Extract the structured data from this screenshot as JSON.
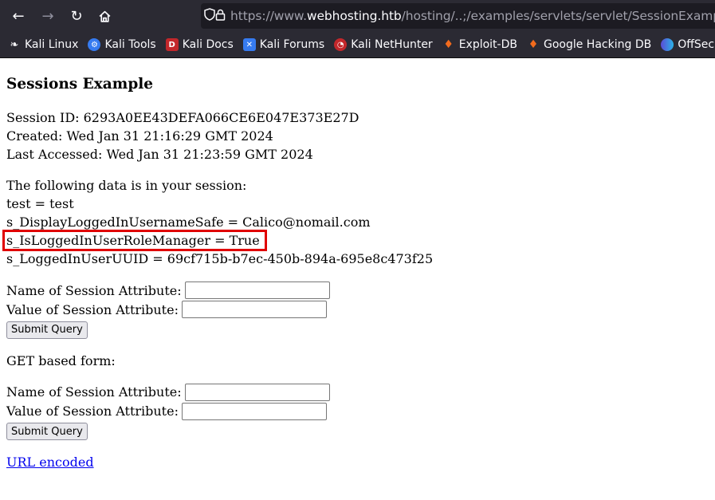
{
  "browser": {
    "url": {
      "scheme": "https://www.",
      "host": "webhosting.htb",
      "path": "/hosting/..;/examples/servlets/servlet/SessionExample"
    },
    "bookmarks": [
      {
        "label": "Kali Linux",
        "icon": "kali-dragon-icon"
      },
      {
        "label": "Kali Tools",
        "icon": "kali-tools-icon"
      },
      {
        "label": "Kali Docs",
        "icon": "kali-docs-icon"
      },
      {
        "label": "Kali Forums",
        "icon": "kali-forums-icon"
      },
      {
        "label": "Kali NetHunter",
        "icon": "kali-nethunter-icon"
      },
      {
        "label": "Exploit-DB",
        "icon": "exploit-db-icon"
      },
      {
        "label": "Google Hacking DB",
        "icon": "ghdb-icon"
      },
      {
        "label": "OffSec",
        "icon": "offsec-icon"
      }
    ]
  },
  "page": {
    "title": "Sessions Example",
    "session_id": "Session ID: 6293A0EE43DEFA066CE6E047E373E27D",
    "created": "Created: Wed Jan 31 21:16:29 GMT 2024",
    "last_accessed": "Last Accessed: Wed Jan 31 21:23:59 GMT 2024",
    "data_intro": "The following data is in your session:",
    "attributes": [
      "test = test",
      "s_DisplayLoggedInUsernameSafe = Calico@nomail.com",
      "s_IsLoggedInUserRoleManager = True",
      "s_LoggedInUserUUID = 69cf715b-b7ec-450b-894a-695e8c473f25"
    ],
    "post_form": {
      "name_label": "Name of Session Attribute:",
      "value_label": "Value of Session Attribute:",
      "submit_label": "Submit Query"
    },
    "get_form_heading": "GET based form:",
    "get_form": {
      "name_label": "Name of Session Attribute:",
      "value_label": "Value of Session Attribute:",
      "submit_label": "Submit Query"
    },
    "url_encoded_link": "URL encoded"
  },
  "colors": {
    "highlight": "#e00000",
    "link": "#0000ee",
    "chrome_bg": "#2b2a33"
  }
}
